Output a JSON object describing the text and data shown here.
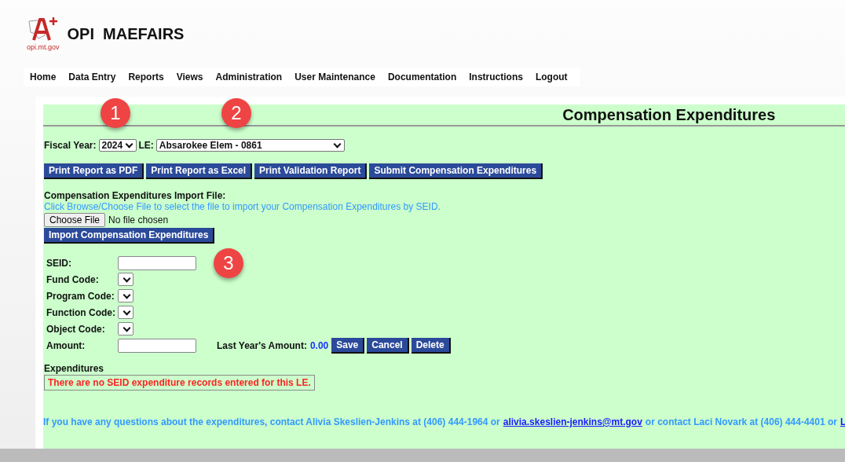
{
  "header": {
    "logo_caption": "opi.mt.gov",
    "title": "OPI  MAEFAIRS"
  },
  "nav": [
    "Home",
    "Data Entry",
    "Reports",
    "Views",
    "Administration",
    "User Maintenance",
    "Documentation",
    "Instructions",
    "Logout"
  ],
  "page_title": "Compensation Expenditures",
  "filters": {
    "fiscal_year_label": "Fiscal Year:",
    "fiscal_year": "2024",
    "le_label": "LE:",
    "le": "Absarokee Elem - 0861"
  },
  "actions": [
    "Print Report as PDF",
    "Print Report as Excel",
    "Print Validation Report",
    "Submit Compensation Expenditures"
  ],
  "import": {
    "heading": "Compensation Expenditures Import File:",
    "hint": "Click Browse/Choose File to select the file to import your Compensation Expenditures by SEID.",
    "choose_button": "Choose File",
    "file_status": "No file chosen",
    "import_button": "Import Compensation Expenditures"
  },
  "form": [
    {
      "label": "SEID:",
      "kind": "text"
    },
    {
      "label": "Fund Code:",
      "kind": "select"
    },
    {
      "label": "Program Code:",
      "kind": "select"
    },
    {
      "label": "Function Code:",
      "kind": "select"
    },
    {
      "label": "Object Code:",
      "kind": "select"
    },
    {
      "label": "Amount:",
      "kind": "text"
    }
  ],
  "last_year": {
    "label": "Last Year's Amount:",
    "value": "0.00"
  },
  "form_buttons": [
    "Save",
    "Cancel",
    "Delete"
  ],
  "expenditures": {
    "heading": "Expenditures",
    "message": "There are no SEID expenditure records entered for this LE."
  },
  "footer": [
    {
      "kind": "text",
      "text": "If you have any questions about the expenditures, contact Alivia Skeslien-Jenkins at (406) 444-1964 or"
    },
    {
      "kind": "link",
      "text": "alivia.skeslien-jenkins@mt.gov"
    },
    {
      "kind": "text",
      "text": "or contact Laci Novark at (406) 444-4401 or"
    },
    {
      "kind": "link",
      "text": "L"
    }
  ],
  "callouts": [
    "1",
    "2",
    "3"
  ]
}
